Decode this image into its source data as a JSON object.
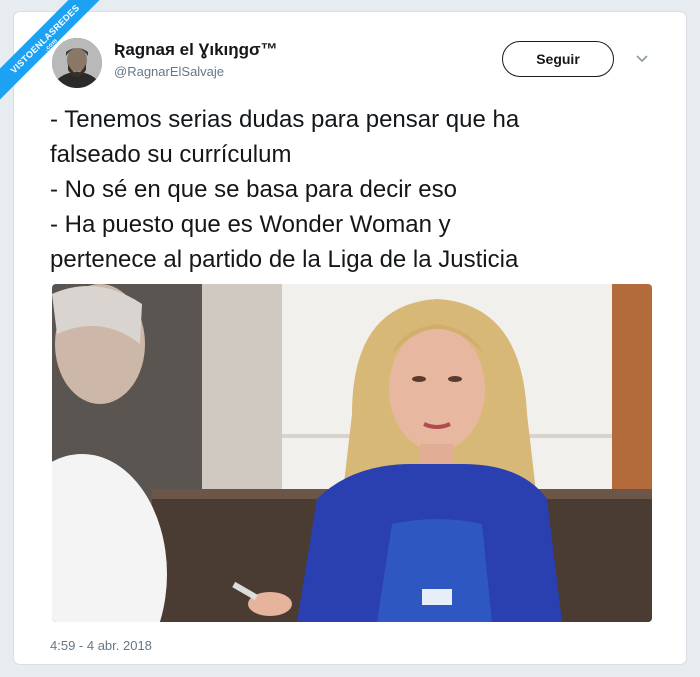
{
  "watermark": {
    "main": "VISTOENLASREDES",
    "sub": ".com"
  },
  "author": {
    "display_name": "Ʀagnaя el Ɣıkıŋgσ™",
    "handle": "@RagnarElSalvaje"
  },
  "follow_label": "Seguir",
  "tweet_lines": [
    "- Tenemos serias dudas para pensar que ha",
    "falseado su currículum",
    "- No sé en que se basa para decir eso",
    "- Ha puesto que es Wonder Woman y",
    "pertenece al partido de la Liga de la Justicia"
  ],
  "timestamp": "4:59 - 4 abr. 2018",
  "colors": {
    "accent": "#1da1f2",
    "text": "#14171a",
    "muted": "#657786"
  },
  "icons": {
    "menu": "chevron-down-icon"
  }
}
